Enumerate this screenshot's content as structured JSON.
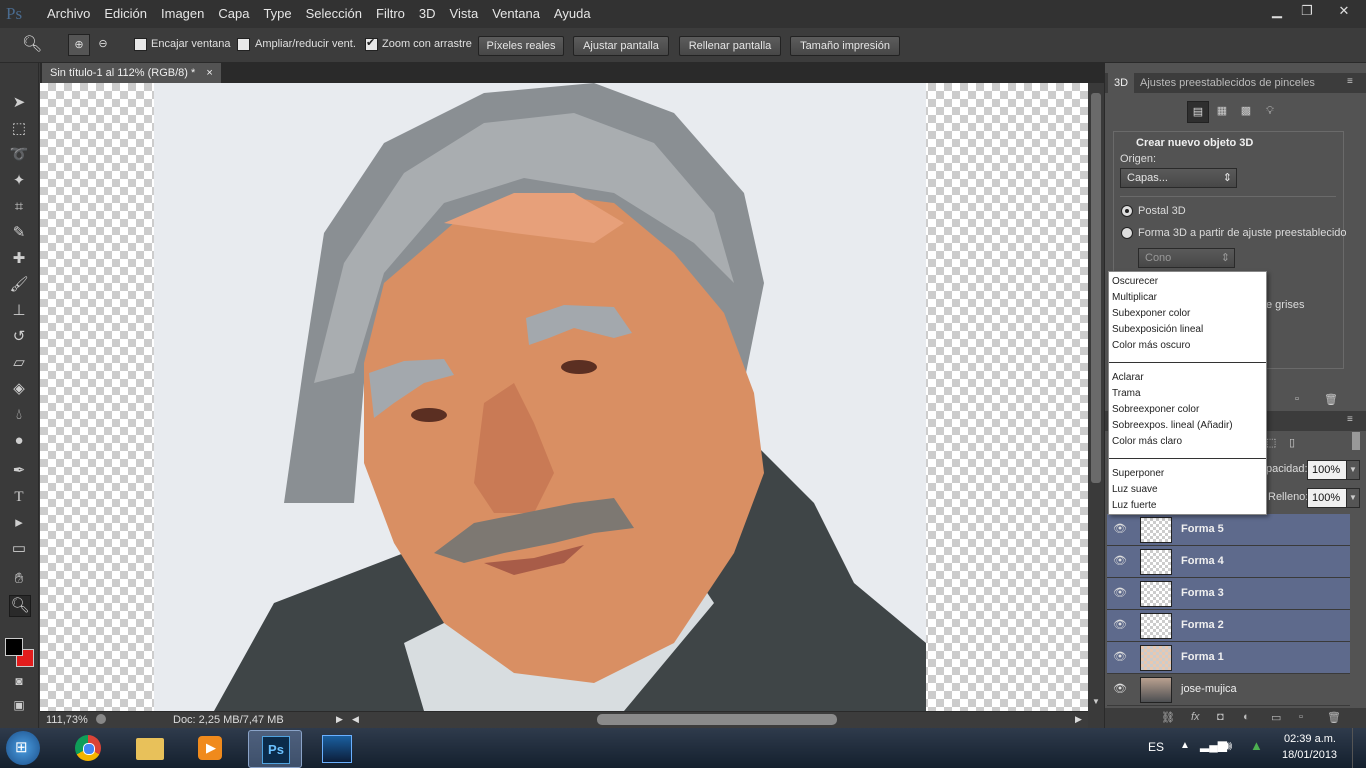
{
  "app": {
    "logo": "Ps"
  },
  "menu": [
    "Archivo",
    "Edición",
    "Imagen",
    "Capa",
    "Type",
    "Selección",
    "Filtro",
    "3D",
    "Vista",
    "Ventana",
    "Ayuda"
  ],
  "options": {
    "fit_window": "Encajar ventana",
    "resize_windows": "Ampliar/reducir vent.",
    "scrubby_zoom": "Zoom con arrastre",
    "actual_pixels": "Píxeles reales",
    "fit_screen": "Ajustar pantalla",
    "fill_screen": "Rellenar pantalla",
    "print_size": "Tamaño impresión",
    "workspace": "3D"
  },
  "document": {
    "tab_title": "Sin título-1 al 112% (RGB/8) *",
    "close": "×"
  },
  "status": {
    "zoom": "111,73%",
    "doc": "Doc: 2,25 MB/7,47 MB"
  },
  "panel3d": {
    "tab_3d": "3D",
    "tab_brushes": "Ajustes preestablecidos de pinceles",
    "section_title": "Crear nuevo objeto 3D",
    "source_label": "Origen:",
    "source_value": "Capas...",
    "opt_postcard": "Postal 3D",
    "opt_shape": "Forma 3D a partir de ajuste preestablecido",
    "shape_value": "Cono",
    "partial_grays": "e grises"
  },
  "layers_panel": {
    "opacity_label": "pacidad:",
    "opacity_value": "100%",
    "fill_label": "Relleno:",
    "fill_value": "100%",
    "layers": [
      {
        "name": "Forma 5",
        "selected": true
      },
      {
        "name": "Forma 4",
        "selected": true
      },
      {
        "name": "Forma 3",
        "selected": true
      },
      {
        "name": "Forma 2",
        "selected": true
      },
      {
        "name": "Forma 1",
        "selected": true
      },
      {
        "name": "jose-mujica",
        "selected": false
      }
    ]
  },
  "blend_menu": {
    "group1": [
      "Oscurecer",
      "Multiplicar",
      "Subexponer color",
      "Subexposición lineal",
      "Color más oscuro"
    ],
    "group2": [
      "Aclarar",
      "Trama",
      "Sobreexponer color",
      "Sobreexpos. lineal (Añadir)",
      "Color más claro"
    ],
    "group3": [
      "Superponer",
      "Luz suave",
      "Luz fuerte"
    ]
  },
  "taskbar": {
    "lang": "ES",
    "time": "02:39 a.m.",
    "date": "18/01/2013"
  },
  "colors": {
    "foreground": "#000000",
    "background": "#e31c1c",
    "selection": "#5e6a8c"
  }
}
